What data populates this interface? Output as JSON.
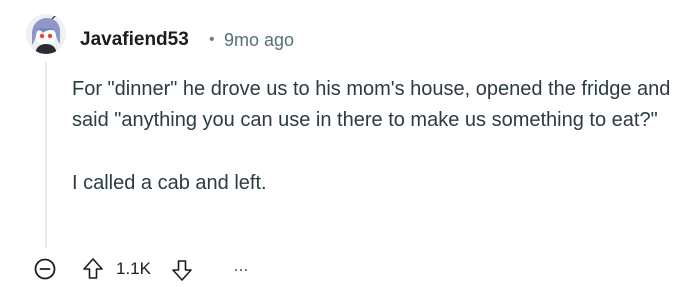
{
  "comment": {
    "username": "Javafiend53",
    "separator": "•",
    "timestamp": "9mo ago",
    "paragraphs": [
      "For \"dinner\" he drove us to his mom's house, opened the fridge and said \"anything you can use in there to make us something to eat?\"",
      "I called a cab and left."
    ],
    "score": "1.1K",
    "more_label": "..."
  },
  "icons": {
    "avatar": "snoo-avatar",
    "collapse": "collapse-icon",
    "upvote": "upvote-icon",
    "downvote": "downvote-icon",
    "more": "more-options-icon"
  },
  "colors": {
    "username": "#1c1c1c",
    "timestamp": "#576f76",
    "body_text": "#2a3c42",
    "icon": "#1c1c1c",
    "thread_line": "#e5ebee"
  }
}
